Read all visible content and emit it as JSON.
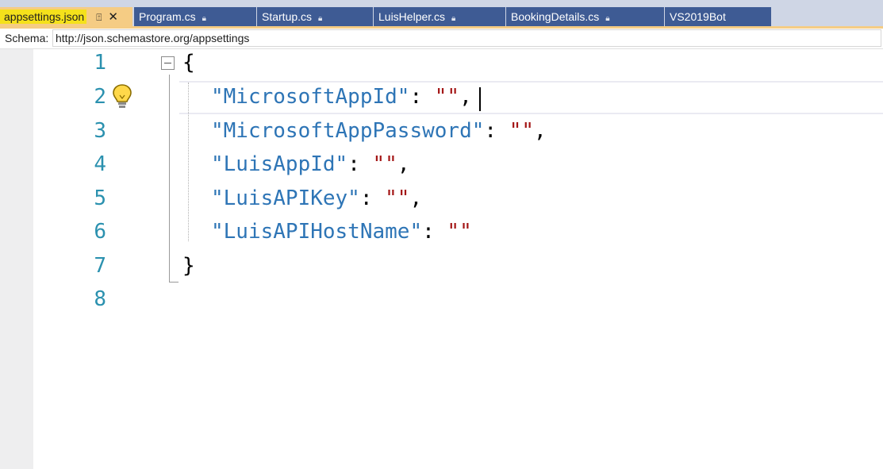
{
  "tabs": [
    {
      "label": "appsettings.json",
      "active": true,
      "pin_icon": "pin-icon",
      "close_icon": "close-icon"
    },
    {
      "label": "Program.cs",
      "lock_icon": "lock-icon"
    },
    {
      "label": "Startup.cs",
      "lock_icon": "lock-icon"
    },
    {
      "label": "LuisHelper.cs",
      "lock_icon": "lock-icon"
    },
    {
      "label": "BookingDetails.cs",
      "lock_icon": "lock-icon"
    },
    {
      "label": "VS2019Bot"
    }
  ],
  "schema": {
    "label": "Schema:",
    "value": "http://json.schemastore.org/appsettings"
  },
  "line_numbers": [
    "1",
    "2",
    "3",
    "4",
    "5",
    "6",
    "7",
    "8"
  ],
  "code": {
    "open_brace": "{",
    "close_brace": "}",
    "entries": [
      {
        "key": "\"MicrosoftAppId\"",
        "value": "\"\"",
        "sep": ",",
        "colon": ": "
      },
      {
        "key": "\"MicrosoftAppPassword\"",
        "value": "\"\"",
        "sep": ",",
        "colon": ": "
      },
      {
        "key": "\"LuisAppId\"",
        "value": "\"\"",
        "sep": ",",
        "colon": ": "
      },
      {
        "key": "\"LuisAPIKey\"",
        "value": "\"\"",
        "sep": ",",
        "colon": ": "
      },
      {
        "key": "\"LuisAPIHostName\"",
        "value": "\"\"",
        "sep": "",
        "colon": ": "
      }
    ]
  },
  "colors": {
    "tab_active": "#f5cc84",
    "tab_inactive": "#3e5b94",
    "line_number": "#2b91af",
    "json_key": "#2e75b6",
    "json_string": "#a31515"
  },
  "icons": {
    "lightbulb": "lightbulb-icon",
    "fold": "collapse-icon"
  }
}
